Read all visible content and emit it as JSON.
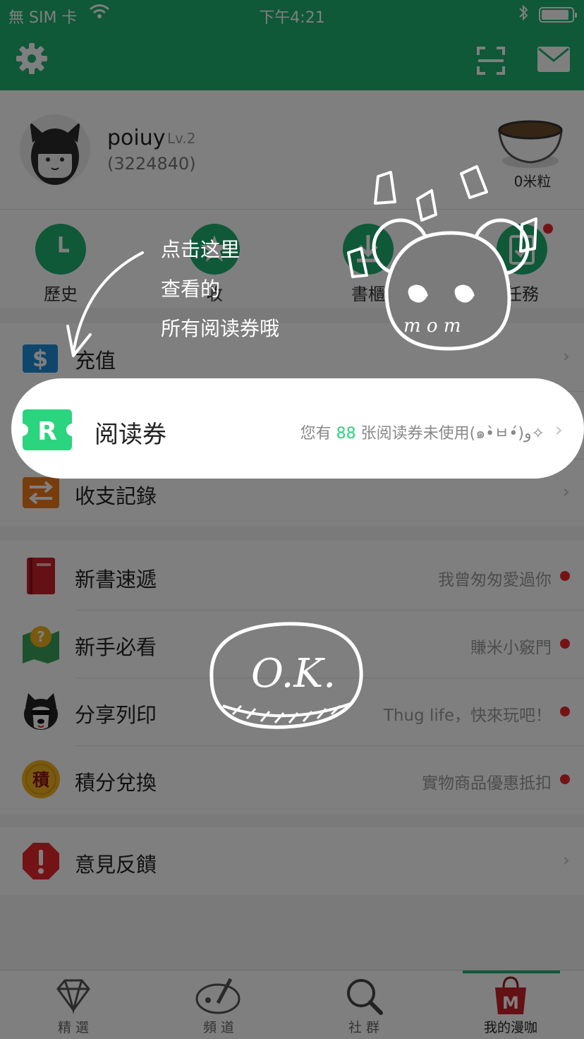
{
  "status_bar": {
    "carrier": "無 SIM 卡",
    "time": "下午4:21"
  },
  "profile": {
    "username": "poiuy",
    "level": "Lv.2",
    "user_id": "(3224840)",
    "rice_count": "0米粒"
  },
  "quick_actions": [
    {
      "label": "歷史",
      "icon": "clock-icon"
    },
    {
      "label": "收",
      "icon": "star-icon"
    },
    {
      "label": "書櫃",
      "icon": "download-icon"
    },
    {
      "label": "任務",
      "icon": "task-icon",
      "badge": true
    }
  ],
  "account_rows": [
    {
      "label": "充值",
      "icon": "dollar-icon"
    },
    {
      "label": "阅读券",
      "icon": "ticket-r-icon"
    },
    {
      "label": "收支記錄",
      "icon": "exchange-icon"
    }
  ],
  "voucher_info": {
    "prefix": "您有",
    "count": "88",
    "suffix": "张阅读券未使用(๑•̀ㅂ•́)و✧"
  },
  "feature_rows": [
    {
      "label": "新書速遞",
      "hint": "我曾匆匆愛過你",
      "icon": "book-icon"
    },
    {
      "label": "新手必看",
      "hint": "賺米小竅門",
      "icon": "map-question-icon"
    },
    {
      "label": "分享列印",
      "hint": "Thug life，快來玩吧！",
      "icon": "husky-icon"
    },
    {
      "label": "積分兌換",
      "hint": "實物商品優惠抵扣",
      "icon": "points-icon"
    }
  ],
  "feedback_row": {
    "label": "意見反饋",
    "icon": "alert-icon"
  },
  "points_icon_char": "積",
  "tabs": [
    {
      "label": "精 選",
      "icon": "diamond-icon"
    },
    {
      "label": "頻 道",
      "icon": "palette-icon"
    },
    {
      "label": "社 群",
      "icon": "search-icon"
    },
    {
      "label": "我的漫咖",
      "icon": "shopping-bag-icon",
      "active": true
    }
  ],
  "annotation": {
    "line1": "点击这里",
    "line2": "查看的",
    "line3": "所有阅读券哦",
    "face_text": "m o m",
    "ok_text": "O.K."
  },
  "colors": {
    "brand_green": "#1fb070",
    "accent_green": "#2bd47e",
    "badge_red": "#e8262d"
  }
}
